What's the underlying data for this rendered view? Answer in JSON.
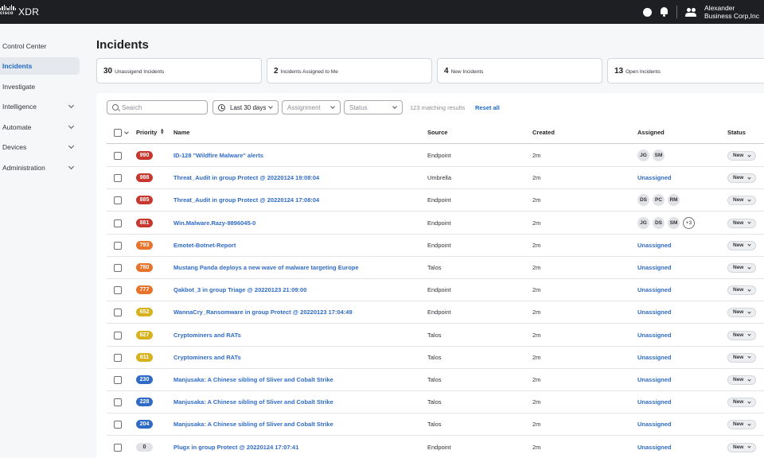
{
  "app": {
    "logo_text": "cisco",
    "brand": "XDR",
    "user_name": "Alexander",
    "user_org": "Business Corp,Inc"
  },
  "sidebar": {
    "items": [
      {
        "label": "Control Center",
        "active": false,
        "expandable": false
      },
      {
        "label": "Incidents",
        "active": true,
        "expandable": false
      },
      {
        "label": "Investigate",
        "active": false,
        "expandable": false
      },
      {
        "label": "Intelligence",
        "active": false,
        "expandable": true
      },
      {
        "label": "Automate",
        "active": false,
        "expandable": true
      },
      {
        "label": "Devices",
        "active": false,
        "expandable": true
      },
      {
        "label": "Administration",
        "active": false,
        "expandable": true
      }
    ]
  },
  "page": {
    "title": "Incidents"
  },
  "summary_cards": [
    {
      "count": "30",
      "label": "Unassigend Incidents"
    },
    {
      "count": "2",
      "label": "Incidents Assigned to Me"
    },
    {
      "count": "4",
      "label": "New Incidents"
    },
    {
      "count": "13",
      "label": "Open Incidents"
    }
  ],
  "filters": {
    "search_placeholder": "Search",
    "date_range": "Last 30 days",
    "assignment_placeholder": "Assignment",
    "status_placeholder": "Status",
    "matching": "123 matching results",
    "reset": "Reset all"
  },
  "table": {
    "columns": {
      "priority": "Priority",
      "name": "Name",
      "source": "Source",
      "created": "Created",
      "assigned": "Assigned",
      "status": "Status"
    },
    "rows": [
      {
        "priority": "990",
        "color": "#c8372d",
        "name": "ID-128 \"Wildfire Malware\" alerts",
        "source": "Endpoint",
        "created": "2m",
        "assigned": [
          "JG",
          "SM"
        ],
        "status": "New"
      },
      {
        "priority": "988",
        "color": "#c8372d",
        "name": "Threat_Audit in group Protect @ 20220124 19:08:04",
        "source": "Umbrella",
        "created": "2m",
        "assigned": "Unassigned",
        "status": "New"
      },
      {
        "priority": "885",
        "color": "#c8372d",
        "name": "Threat_Audit in group Protect @ 20220124 17:08:04",
        "source": "Endpoint",
        "created": "2m",
        "assigned": [
          "DS",
          "PC",
          "RM"
        ],
        "status": "New"
      },
      {
        "priority": "881",
        "color": "#c8372d",
        "name": "Win.Malware.Razy-9896045-0",
        "source": "Endpoint",
        "created": "2m",
        "assigned": [
          "JG",
          "DS",
          "SM",
          "+3"
        ],
        "status": "New"
      },
      {
        "priority": "793",
        "color": "#e8742c",
        "name": "Emotet-Botnet-Report",
        "source": "Endpoint",
        "created": "2m",
        "assigned": "Unassigned",
        "status": "New"
      },
      {
        "priority": "780",
        "color": "#e8742c",
        "name": "Mustang Panda deploys a new wave of malware targeting Europe",
        "source": "Talos",
        "created": "2m",
        "assigned": "Unassigned",
        "status": "New"
      },
      {
        "priority": "777",
        "color": "#e8742c",
        "name": "Qakbot_3 in group Triage @ 20220123 21:09:00",
        "source": "Endpoint",
        "created": "2m",
        "assigned": "Unassigned",
        "status": "New"
      },
      {
        "priority": "652",
        "color": "#d7b21c",
        "name": "WannaCry_Ransomware in group Protect @ 20220123 17:04:49",
        "source": "Endpoint",
        "created": "2m",
        "assigned": "Unassigned",
        "status": "New"
      },
      {
        "priority": "627",
        "color": "#d7b21c",
        "name": "Cryptominers and RATs",
        "source": "Talos",
        "created": "2m",
        "assigned": "Unassigned",
        "status": "New"
      },
      {
        "priority": "611",
        "color": "#d7b21c",
        "name": "Cryptominers and RATs",
        "source": "Talos",
        "created": "2m",
        "assigned": "Unassigned",
        "status": "New"
      },
      {
        "priority": "230",
        "color": "#2f6bc6",
        "name": "Manjusaka: A Chinese sibling of Sliver and Cobalt Strike",
        "source": "Talos",
        "created": "2m",
        "assigned": "Unassigned",
        "status": "New"
      },
      {
        "priority": "228",
        "color": "#2f6bc6",
        "name": "Manjusaka: A Chinese sibling of Sliver and Cobalt Strike",
        "source": "Talos",
        "created": "2m",
        "assigned": "Unassigned",
        "status": "New"
      },
      {
        "priority": "204",
        "color": "#2f6bc6",
        "name": "Manjusaka: A Chinese sibling of Sliver and Cobalt Strike",
        "source": "Talos",
        "created": "2m",
        "assigned": "Unassigned",
        "status": "New"
      },
      {
        "priority": "0",
        "color": "#e0e2e5",
        "name": "Plugx in group Protect @ 20220124 17:07:41",
        "source": "Endpoint",
        "created": "2m",
        "assigned": "Unassigned",
        "status": "New"
      }
    ]
  }
}
